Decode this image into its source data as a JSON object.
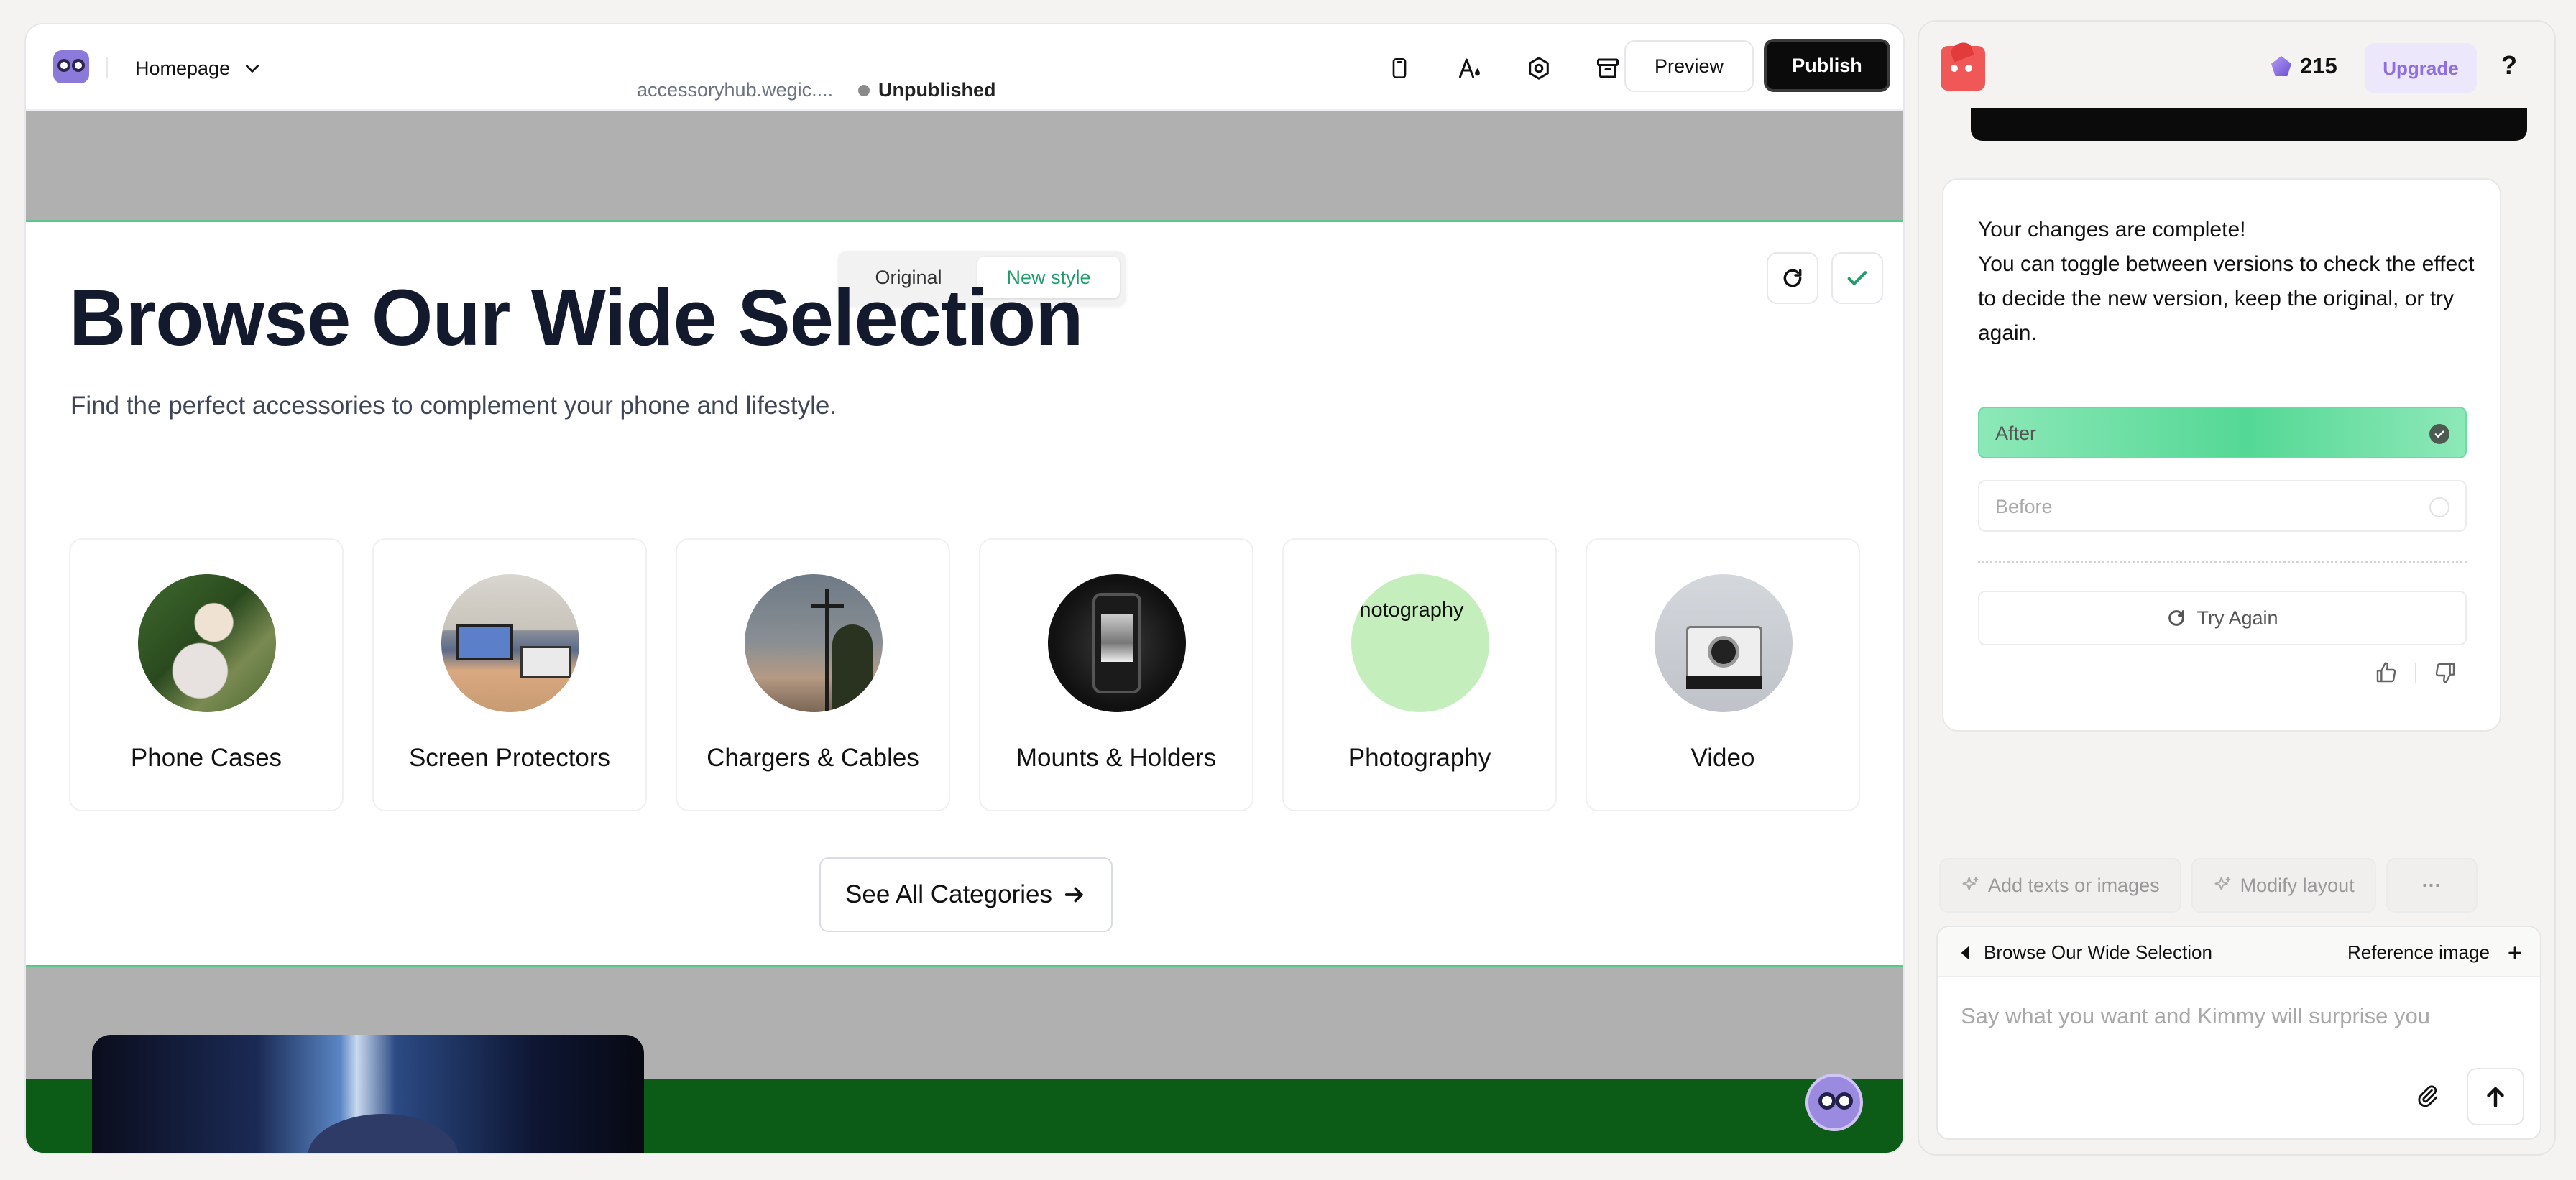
{
  "topbar": {
    "page_name": "Homepage",
    "domain": "accessoryhub.wegic....",
    "status": "Unpublished",
    "preview_label": "Preview",
    "publish_label": "Publish",
    "icons": [
      "mobile-icon",
      "font-color-icon",
      "settings-icon",
      "archive-icon"
    ]
  },
  "toggle": {
    "original": "Original",
    "new_style": "New style"
  },
  "section": {
    "title": "Browse Our Wide Selection",
    "subtitle": "Find the perfect accessories to complement your phone and lifestyle.",
    "categories": [
      {
        "label": "Phone Cases",
        "image_text": ""
      },
      {
        "label": "Screen Protectors",
        "image_text": ""
      },
      {
        "label": "Chargers & Cables",
        "image_text": ""
      },
      {
        "label": "Mounts & Holders",
        "image_text": ""
      },
      {
        "label": "Photography",
        "image_text": "Photography"
      },
      {
        "label": "Video",
        "image_text": ""
      }
    ],
    "see_all": "See All Categories"
  },
  "assistant": {
    "credits": "215",
    "upgrade_label": "Upgrade",
    "help_label": "?",
    "message_line1": "Your changes are complete!",
    "message_line2": "You can toggle between versions to check the effect to decide the new version, keep the original, or try again.",
    "after_label": "After",
    "before_label": "Before",
    "try_again_label": "Try Again",
    "chips": [
      "Add texts or images",
      "Modify layout",
      "···"
    ],
    "context_label": "Browse Our Wide Selection",
    "reference_label": "Reference image",
    "input_placeholder": "Say what you want and Kimmy will surprise you"
  },
  "colors": {
    "accent_green": "#1f9d6a",
    "selection_outline": "#5cc48d",
    "upgrade_purple": "#8f6ee0",
    "publish_bg": "#0b0b0b",
    "footer_green": "#0c5b16"
  }
}
